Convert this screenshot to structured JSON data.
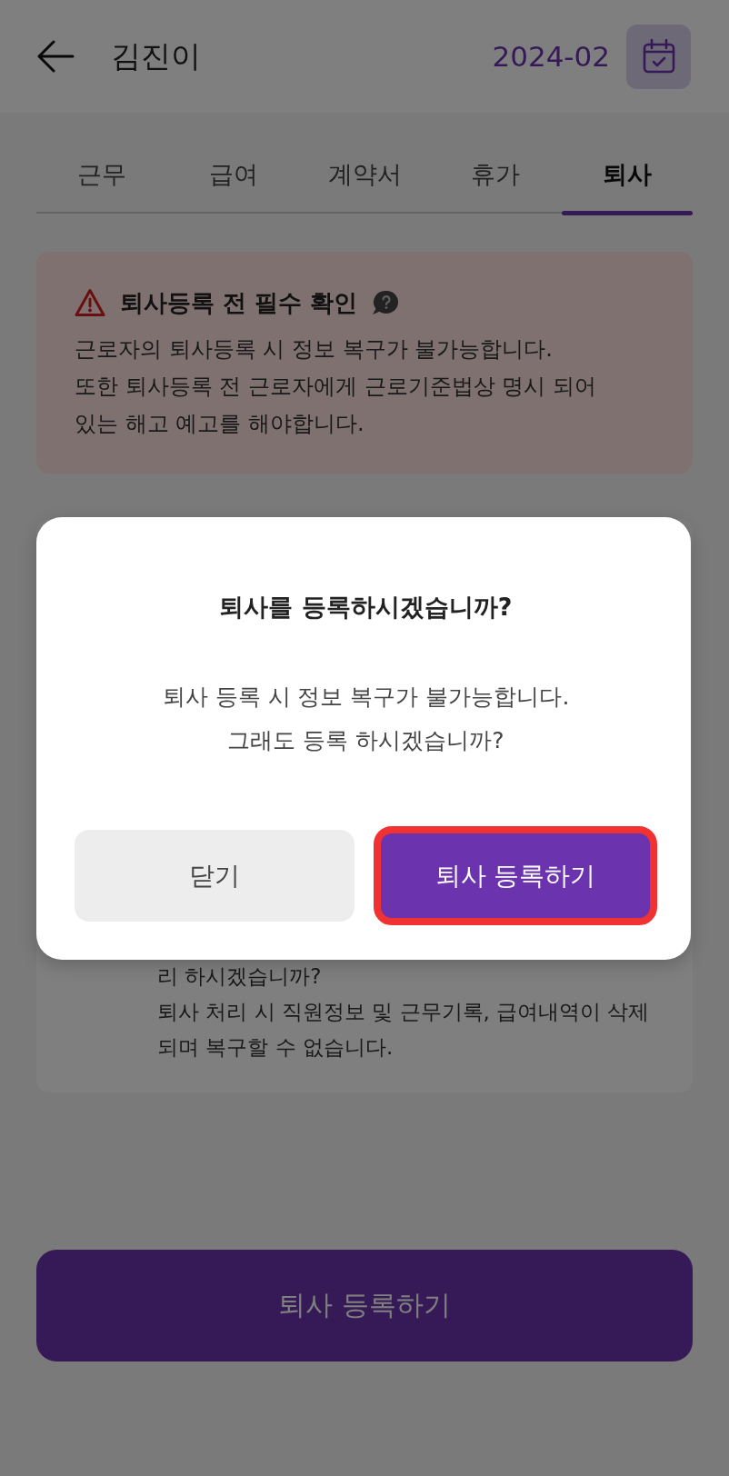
{
  "header": {
    "title": "김진이",
    "month": "2024-02"
  },
  "tabs": [
    {
      "label": "근무",
      "selected": false
    },
    {
      "label": "급여",
      "selected": false
    },
    {
      "label": "계약서",
      "selected": false
    },
    {
      "label": "휴가",
      "selected": false
    },
    {
      "label": "퇴사",
      "selected": true
    }
  ],
  "notice": {
    "title": "퇴사등록 전 필수 확인",
    "lines": [
      "근로자의 퇴사등록 시 정보 복구가 불가능합니다.",
      "또한 퇴사등록 전 근로자에게 근로기준법상 명시 되어",
      "있는 해고 예고를 해야합니다."
    ]
  },
  "info_card": {
    "lines": [
      "리 하시겠습니까?",
      "퇴사 처리 시 직원정보 및 근무기록, 급여내역이 삭제",
      "되며 복구할 수 없습니다."
    ]
  },
  "submit_button": {
    "label": "퇴사 등록하기"
  },
  "dialog": {
    "title": "퇴사를 등록하시겠습니까?",
    "lines": [
      "퇴사 등록 시 정보 복구가 불가능합니다.",
      "그래도 등록 하시겠습니까?"
    ],
    "buttons": [
      {
        "label": "닫기",
        "kind": "secondary",
        "highlighted": false
      },
      {
        "label": "퇴사 등록하기",
        "kind": "primary",
        "highlighted": true
      }
    ]
  }
}
